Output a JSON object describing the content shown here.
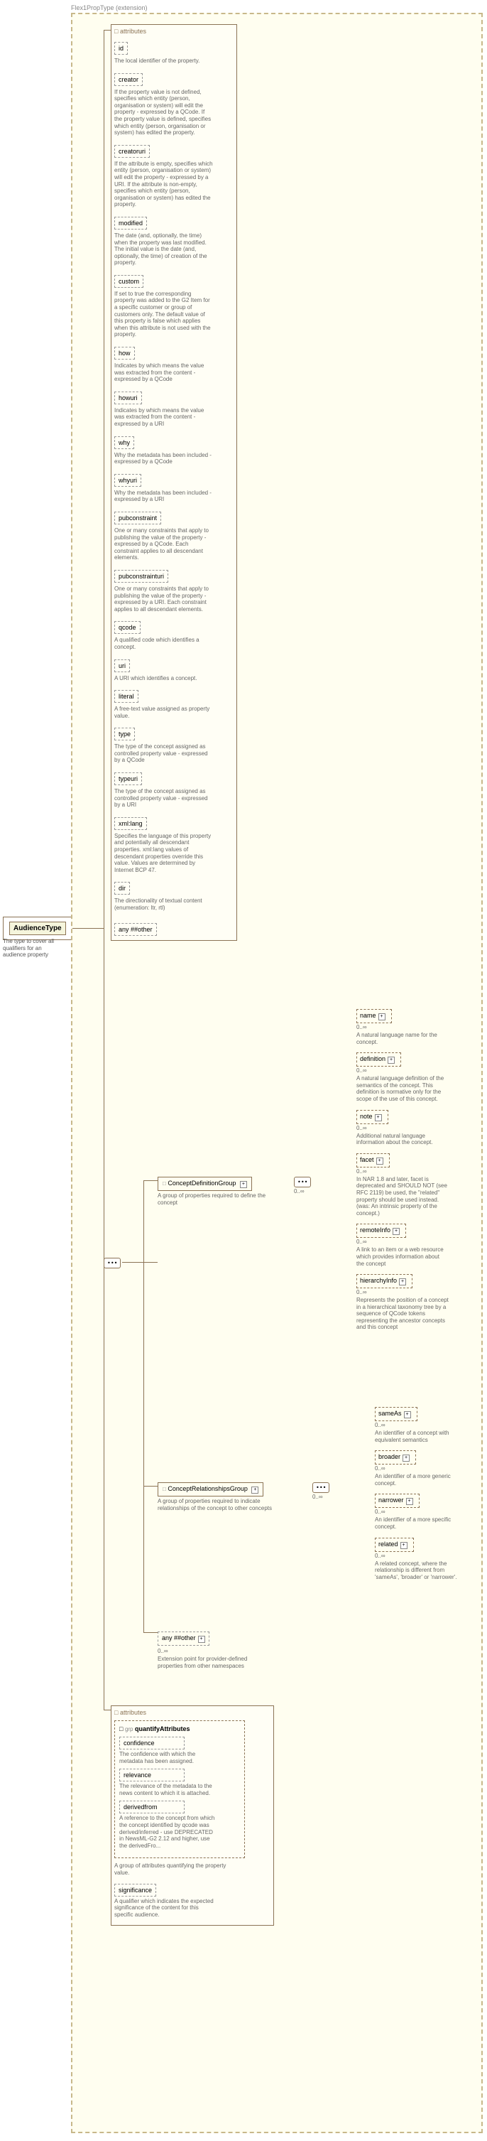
{
  "header_text": "Flex1PropType (extension)",
  "root": {
    "name": "AudienceType",
    "desc": "The type to cover all qualifiers for an audience property"
  },
  "attributes_label": "attributes",
  "any_other": "any ##other",
  "seq_symbol": "•••",
  "card_0inf": "0..∞",
  "attrs": [
    {
      "name": "id",
      "desc": "The local identifier of the property."
    },
    {
      "name": "creator",
      "desc": "If the property value is not defined, specifies which entity (person, organisation or system) will edit the property - expressed by a QCode. If the property value is defined, specifies which entity (person, organisation or system) has edited the property."
    },
    {
      "name": "creatoruri",
      "desc": "If the attribute is empty, specifies which entity (person, organisation or system) will edit the property - expressed by a URI. If the attribute is non-empty, specifies which entity (person, organisation or system) has edited the property."
    },
    {
      "name": "modified",
      "desc": "The date (and, optionally, the time) when the property was last modified. The initial value is the date (and, optionally, the time) of creation of the property."
    },
    {
      "name": "custom",
      "desc": "If set to true the corresponding property was added to the G2 Item for a specific customer or group of customers only. The default value of this property is false which applies when this attribute is not used with the property."
    },
    {
      "name": "how",
      "desc": "Indicates by which means the value was extracted from the content - expressed by a QCode"
    },
    {
      "name": "howuri",
      "desc": "Indicates by which means the value was extracted from the content - expressed by a URI"
    },
    {
      "name": "why",
      "desc": "Why the metadata has been included - expressed by a QCode"
    },
    {
      "name": "whyuri",
      "desc": "Why the metadata has been included - expressed by a URI"
    },
    {
      "name": "pubconstraint",
      "desc": "One or many constraints that apply to publishing the value of the property - expressed by a QCode. Each constraint applies to all descendant elements."
    },
    {
      "name": "pubconstrainturi",
      "desc": "One or many constraints that apply to publishing the value of the property - expressed by a URI. Each constraint applies to all descendant elements."
    },
    {
      "name": "qcode",
      "desc": "A qualified code which identifies a concept."
    },
    {
      "name": "uri",
      "desc": "A URI which identifies a concept."
    },
    {
      "name": "literal",
      "desc": "A free-text value assigned as property value."
    },
    {
      "name": "type",
      "desc": "The type of the concept assigned as controlled property value - expressed by a QCode"
    },
    {
      "name": "typeuri",
      "desc": "The type of the concept assigned as controlled property value - expressed by a URI"
    },
    {
      "name": "xml:lang",
      "desc": "Specifies the language of this property and potentially all descendant properties. xml:lang values of descendant properties override this value. Values are determined by Internet BCP 47."
    },
    {
      "name": "dir",
      "desc": "The directionality of textual content (enumeration: ltr, rtl)"
    }
  ],
  "groups": {
    "cdg": {
      "name": "ConceptDefinitionGroup",
      "desc": "A group of properties required to define the concept"
    },
    "crg": {
      "name": "ConceptRelationshipsGroup",
      "desc": "A group of properties required to indicate relationships of the concept to other concepts"
    }
  },
  "cdg_children": [
    {
      "name": "name",
      "desc": "A natural language name for the concept."
    },
    {
      "name": "definition",
      "desc": "A natural language definition of the semantics of the concept. This definition is normative only for the scope of the use of this concept."
    },
    {
      "name": "note",
      "desc": "Additional natural language information about the concept."
    },
    {
      "name": "facet",
      "desc": "In NAR 1.8 and later, facet is deprecated and SHOULD NOT (see RFC 2119) be used, the \"related\" property should be used instead. (was: An intrinsic property of the concept.)"
    },
    {
      "name": "remoteInfo",
      "desc": "A link to an item or a web resource which provides information about the concept"
    },
    {
      "name": "hierarchyInfo",
      "desc": "Represents the position of a concept in a hierarchical taxonomy tree by a sequence of QCode tokens representing the ancestor concepts and this concept"
    }
  ],
  "crg_children": [
    {
      "name": "sameAs",
      "desc": "An identifier of a concept with equivalent semantics"
    },
    {
      "name": "broader",
      "desc": "An identifier of a more generic concept."
    },
    {
      "name": "narrower",
      "desc": "An identifier of a more specific concept."
    },
    {
      "name": "related",
      "desc": "A related concept, where the relationship is different from 'sameAs', 'broader' or 'narrower'."
    }
  ],
  "ext": {
    "name": "any ##other",
    "desc": "Extension point for provider-defined properties from other namespaces"
  },
  "quant": {
    "group_name": "quantifyAttributes",
    "group_label": "grp",
    "desc": "A group of attributes quantifying the property value.",
    "attrs": [
      {
        "name": "confidence",
        "desc": "The confidence with which the metadata has been assigned."
      },
      {
        "name": "relevance",
        "desc": "The relevance of the metadata to the news content to which it is attached."
      },
      {
        "name": "derivedfrom",
        "desc": "A reference to the concept from which the concept identified by qcode was derived/inferred - use DEPRECATED in NewsML-G2 2.12 and higher, use the derivedFro..."
      }
    ],
    "significance": {
      "name": "significance",
      "desc": "A qualifier which indicates the expected significance of the content for this specific audience."
    }
  },
  "plus": "+"
}
